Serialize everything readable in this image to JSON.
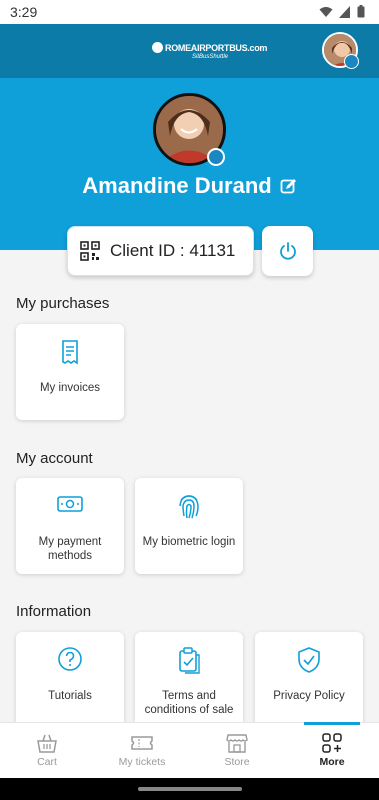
{
  "status_bar": {
    "time": "3:29",
    "icons": [
      "wifi-icon",
      "signal-icon",
      "battery-icon"
    ]
  },
  "header": {
    "logo_text": "ROMEAIRPORTBUS.com",
    "logo_sub": "SitBusShuttle",
    "avatar": "user-avatar"
  },
  "profile": {
    "name": "Amandine Durand",
    "client_id": "Client ID : 41131"
  },
  "sections": {
    "purchases": {
      "title": "My purchases",
      "items": [
        {
          "label": "My invoices",
          "icon": "invoice-icon"
        }
      ]
    },
    "account": {
      "title": "My account",
      "items": [
        {
          "label": "My payment methods",
          "icon": "cash-icon"
        },
        {
          "label": "My biometric login",
          "icon": "fingerprint-icon"
        }
      ]
    },
    "information": {
      "title": "Information",
      "items": [
        {
          "label": "Tutorials",
          "icon": "help-circle-icon"
        },
        {
          "label": "Terms and conditions of sale",
          "icon": "clipboard-check-icon"
        },
        {
          "label": "Privacy Policy",
          "icon": "shield-check-icon"
        }
      ]
    }
  },
  "bottom_nav": {
    "items": [
      {
        "label": "Cart",
        "icon": "basket-icon"
      },
      {
        "label": "My tickets",
        "icon": "ticket-icon"
      },
      {
        "label": "Store",
        "icon": "store-icon"
      },
      {
        "label": "More",
        "icon": "grid-plus-icon"
      }
    ],
    "active": "More"
  },
  "colors": {
    "header_dark": "#0d7ba7",
    "hero_blue": "#0f9fd9",
    "accent": "#1b87c0",
    "page_bg": "#f4f4f4"
  }
}
